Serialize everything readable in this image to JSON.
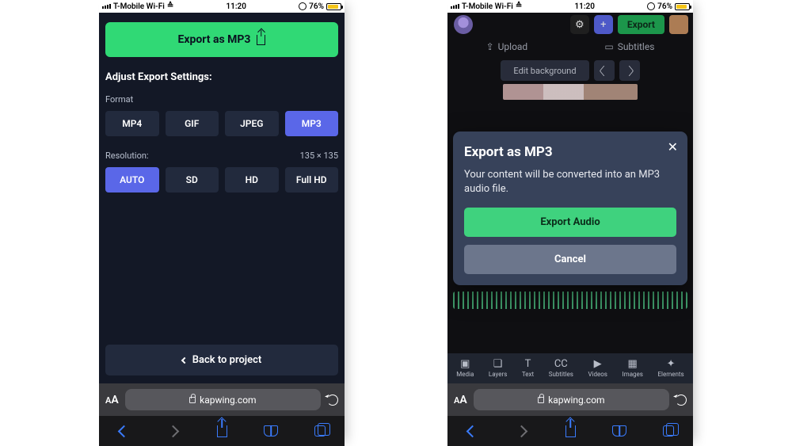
{
  "status_bar": {
    "carrier": "T-Mobile Wi-Fi",
    "time": "11:20",
    "battery_pct": "76%"
  },
  "screen1": {
    "export_main": "Export as MP3",
    "settings_title": "Adjust Export Settings:",
    "format_label": "Format",
    "formats": [
      "MP4",
      "GIF",
      "JPEG",
      "MP3"
    ],
    "format_selected_index": 3,
    "resolution_label": "Resolution:",
    "resolution_value": "135 × 135",
    "resolutions": [
      "AUTO",
      "SD",
      "HD",
      "Full HD"
    ],
    "resolution_selected_index": 0,
    "back_label": "Back to project"
  },
  "screen2": {
    "header": {
      "export_label": "Export",
      "upload_label": "Upload",
      "subtitles_label": "Subtitles",
      "edit_bg": "Edit background"
    },
    "modal": {
      "title": "Export as MP3",
      "body": "Your content will be converted into an MP3 audio file.",
      "primary": "Export Audio",
      "secondary": "Cancel"
    },
    "tabs": [
      "Media",
      "Layers",
      "Text",
      "Subtitles",
      "Videos",
      "Images",
      "Elements"
    ],
    "tab_icons": [
      "▣",
      "❏",
      "T",
      "CC",
      "▶",
      "▦",
      "✦"
    ]
  },
  "browser": {
    "url": "kapwing.com"
  }
}
